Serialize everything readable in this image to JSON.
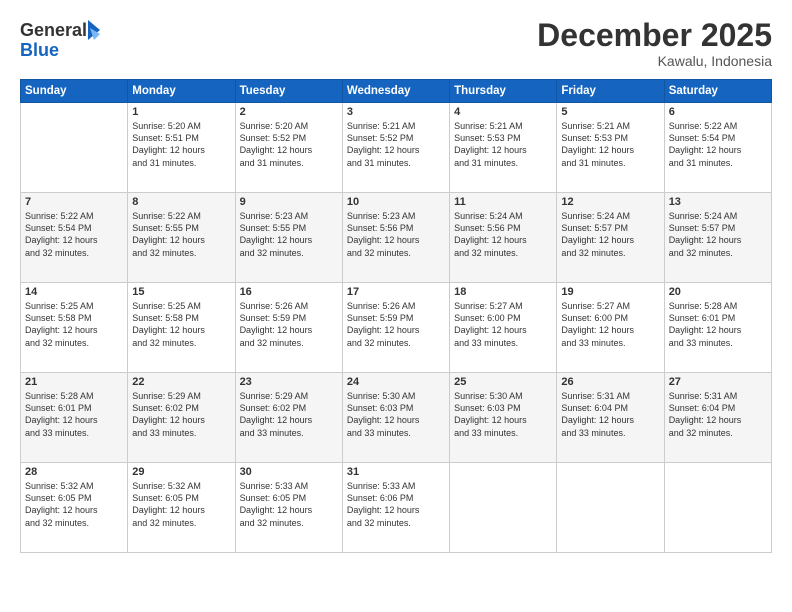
{
  "header": {
    "logo_line1": "General",
    "logo_line2": "Blue",
    "month": "December 2025",
    "location": "Kawalu, Indonesia"
  },
  "days_of_week": [
    "Sunday",
    "Monday",
    "Tuesday",
    "Wednesday",
    "Thursday",
    "Friday",
    "Saturday"
  ],
  "weeks": [
    [
      {
        "day": "",
        "info": ""
      },
      {
        "day": "1",
        "info": "Sunrise: 5:20 AM\nSunset: 5:51 PM\nDaylight: 12 hours\nand 31 minutes."
      },
      {
        "day": "2",
        "info": "Sunrise: 5:20 AM\nSunset: 5:52 PM\nDaylight: 12 hours\nand 31 minutes."
      },
      {
        "day": "3",
        "info": "Sunrise: 5:21 AM\nSunset: 5:52 PM\nDaylight: 12 hours\nand 31 minutes."
      },
      {
        "day": "4",
        "info": "Sunrise: 5:21 AM\nSunset: 5:53 PM\nDaylight: 12 hours\nand 31 minutes."
      },
      {
        "day": "5",
        "info": "Sunrise: 5:21 AM\nSunset: 5:53 PM\nDaylight: 12 hours\nand 31 minutes."
      },
      {
        "day": "6",
        "info": "Sunrise: 5:22 AM\nSunset: 5:54 PM\nDaylight: 12 hours\nand 31 minutes."
      }
    ],
    [
      {
        "day": "7",
        "info": "Sunrise: 5:22 AM\nSunset: 5:54 PM\nDaylight: 12 hours\nand 32 minutes."
      },
      {
        "day": "8",
        "info": "Sunrise: 5:22 AM\nSunset: 5:55 PM\nDaylight: 12 hours\nand 32 minutes."
      },
      {
        "day": "9",
        "info": "Sunrise: 5:23 AM\nSunset: 5:55 PM\nDaylight: 12 hours\nand 32 minutes."
      },
      {
        "day": "10",
        "info": "Sunrise: 5:23 AM\nSunset: 5:56 PM\nDaylight: 12 hours\nand 32 minutes."
      },
      {
        "day": "11",
        "info": "Sunrise: 5:24 AM\nSunset: 5:56 PM\nDaylight: 12 hours\nand 32 minutes."
      },
      {
        "day": "12",
        "info": "Sunrise: 5:24 AM\nSunset: 5:57 PM\nDaylight: 12 hours\nand 32 minutes."
      },
      {
        "day": "13",
        "info": "Sunrise: 5:24 AM\nSunset: 5:57 PM\nDaylight: 12 hours\nand 32 minutes."
      }
    ],
    [
      {
        "day": "14",
        "info": "Sunrise: 5:25 AM\nSunset: 5:58 PM\nDaylight: 12 hours\nand 32 minutes."
      },
      {
        "day": "15",
        "info": "Sunrise: 5:25 AM\nSunset: 5:58 PM\nDaylight: 12 hours\nand 32 minutes."
      },
      {
        "day": "16",
        "info": "Sunrise: 5:26 AM\nSunset: 5:59 PM\nDaylight: 12 hours\nand 32 minutes."
      },
      {
        "day": "17",
        "info": "Sunrise: 5:26 AM\nSunset: 5:59 PM\nDaylight: 12 hours\nand 32 minutes."
      },
      {
        "day": "18",
        "info": "Sunrise: 5:27 AM\nSunset: 6:00 PM\nDaylight: 12 hours\nand 33 minutes."
      },
      {
        "day": "19",
        "info": "Sunrise: 5:27 AM\nSunset: 6:00 PM\nDaylight: 12 hours\nand 33 minutes."
      },
      {
        "day": "20",
        "info": "Sunrise: 5:28 AM\nSunset: 6:01 PM\nDaylight: 12 hours\nand 33 minutes."
      }
    ],
    [
      {
        "day": "21",
        "info": "Sunrise: 5:28 AM\nSunset: 6:01 PM\nDaylight: 12 hours\nand 33 minutes."
      },
      {
        "day": "22",
        "info": "Sunrise: 5:29 AM\nSunset: 6:02 PM\nDaylight: 12 hours\nand 33 minutes."
      },
      {
        "day": "23",
        "info": "Sunrise: 5:29 AM\nSunset: 6:02 PM\nDaylight: 12 hours\nand 33 minutes."
      },
      {
        "day": "24",
        "info": "Sunrise: 5:30 AM\nSunset: 6:03 PM\nDaylight: 12 hours\nand 33 minutes."
      },
      {
        "day": "25",
        "info": "Sunrise: 5:30 AM\nSunset: 6:03 PM\nDaylight: 12 hours\nand 33 minutes."
      },
      {
        "day": "26",
        "info": "Sunrise: 5:31 AM\nSunset: 6:04 PM\nDaylight: 12 hours\nand 33 minutes."
      },
      {
        "day": "27",
        "info": "Sunrise: 5:31 AM\nSunset: 6:04 PM\nDaylight: 12 hours\nand 32 minutes."
      }
    ],
    [
      {
        "day": "28",
        "info": "Sunrise: 5:32 AM\nSunset: 6:05 PM\nDaylight: 12 hours\nand 32 minutes."
      },
      {
        "day": "29",
        "info": "Sunrise: 5:32 AM\nSunset: 6:05 PM\nDaylight: 12 hours\nand 32 minutes."
      },
      {
        "day": "30",
        "info": "Sunrise: 5:33 AM\nSunset: 6:05 PM\nDaylight: 12 hours\nand 32 minutes."
      },
      {
        "day": "31",
        "info": "Sunrise: 5:33 AM\nSunset: 6:06 PM\nDaylight: 12 hours\nand 32 minutes."
      },
      {
        "day": "",
        "info": ""
      },
      {
        "day": "",
        "info": ""
      },
      {
        "day": "",
        "info": ""
      }
    ]
  ]
}
